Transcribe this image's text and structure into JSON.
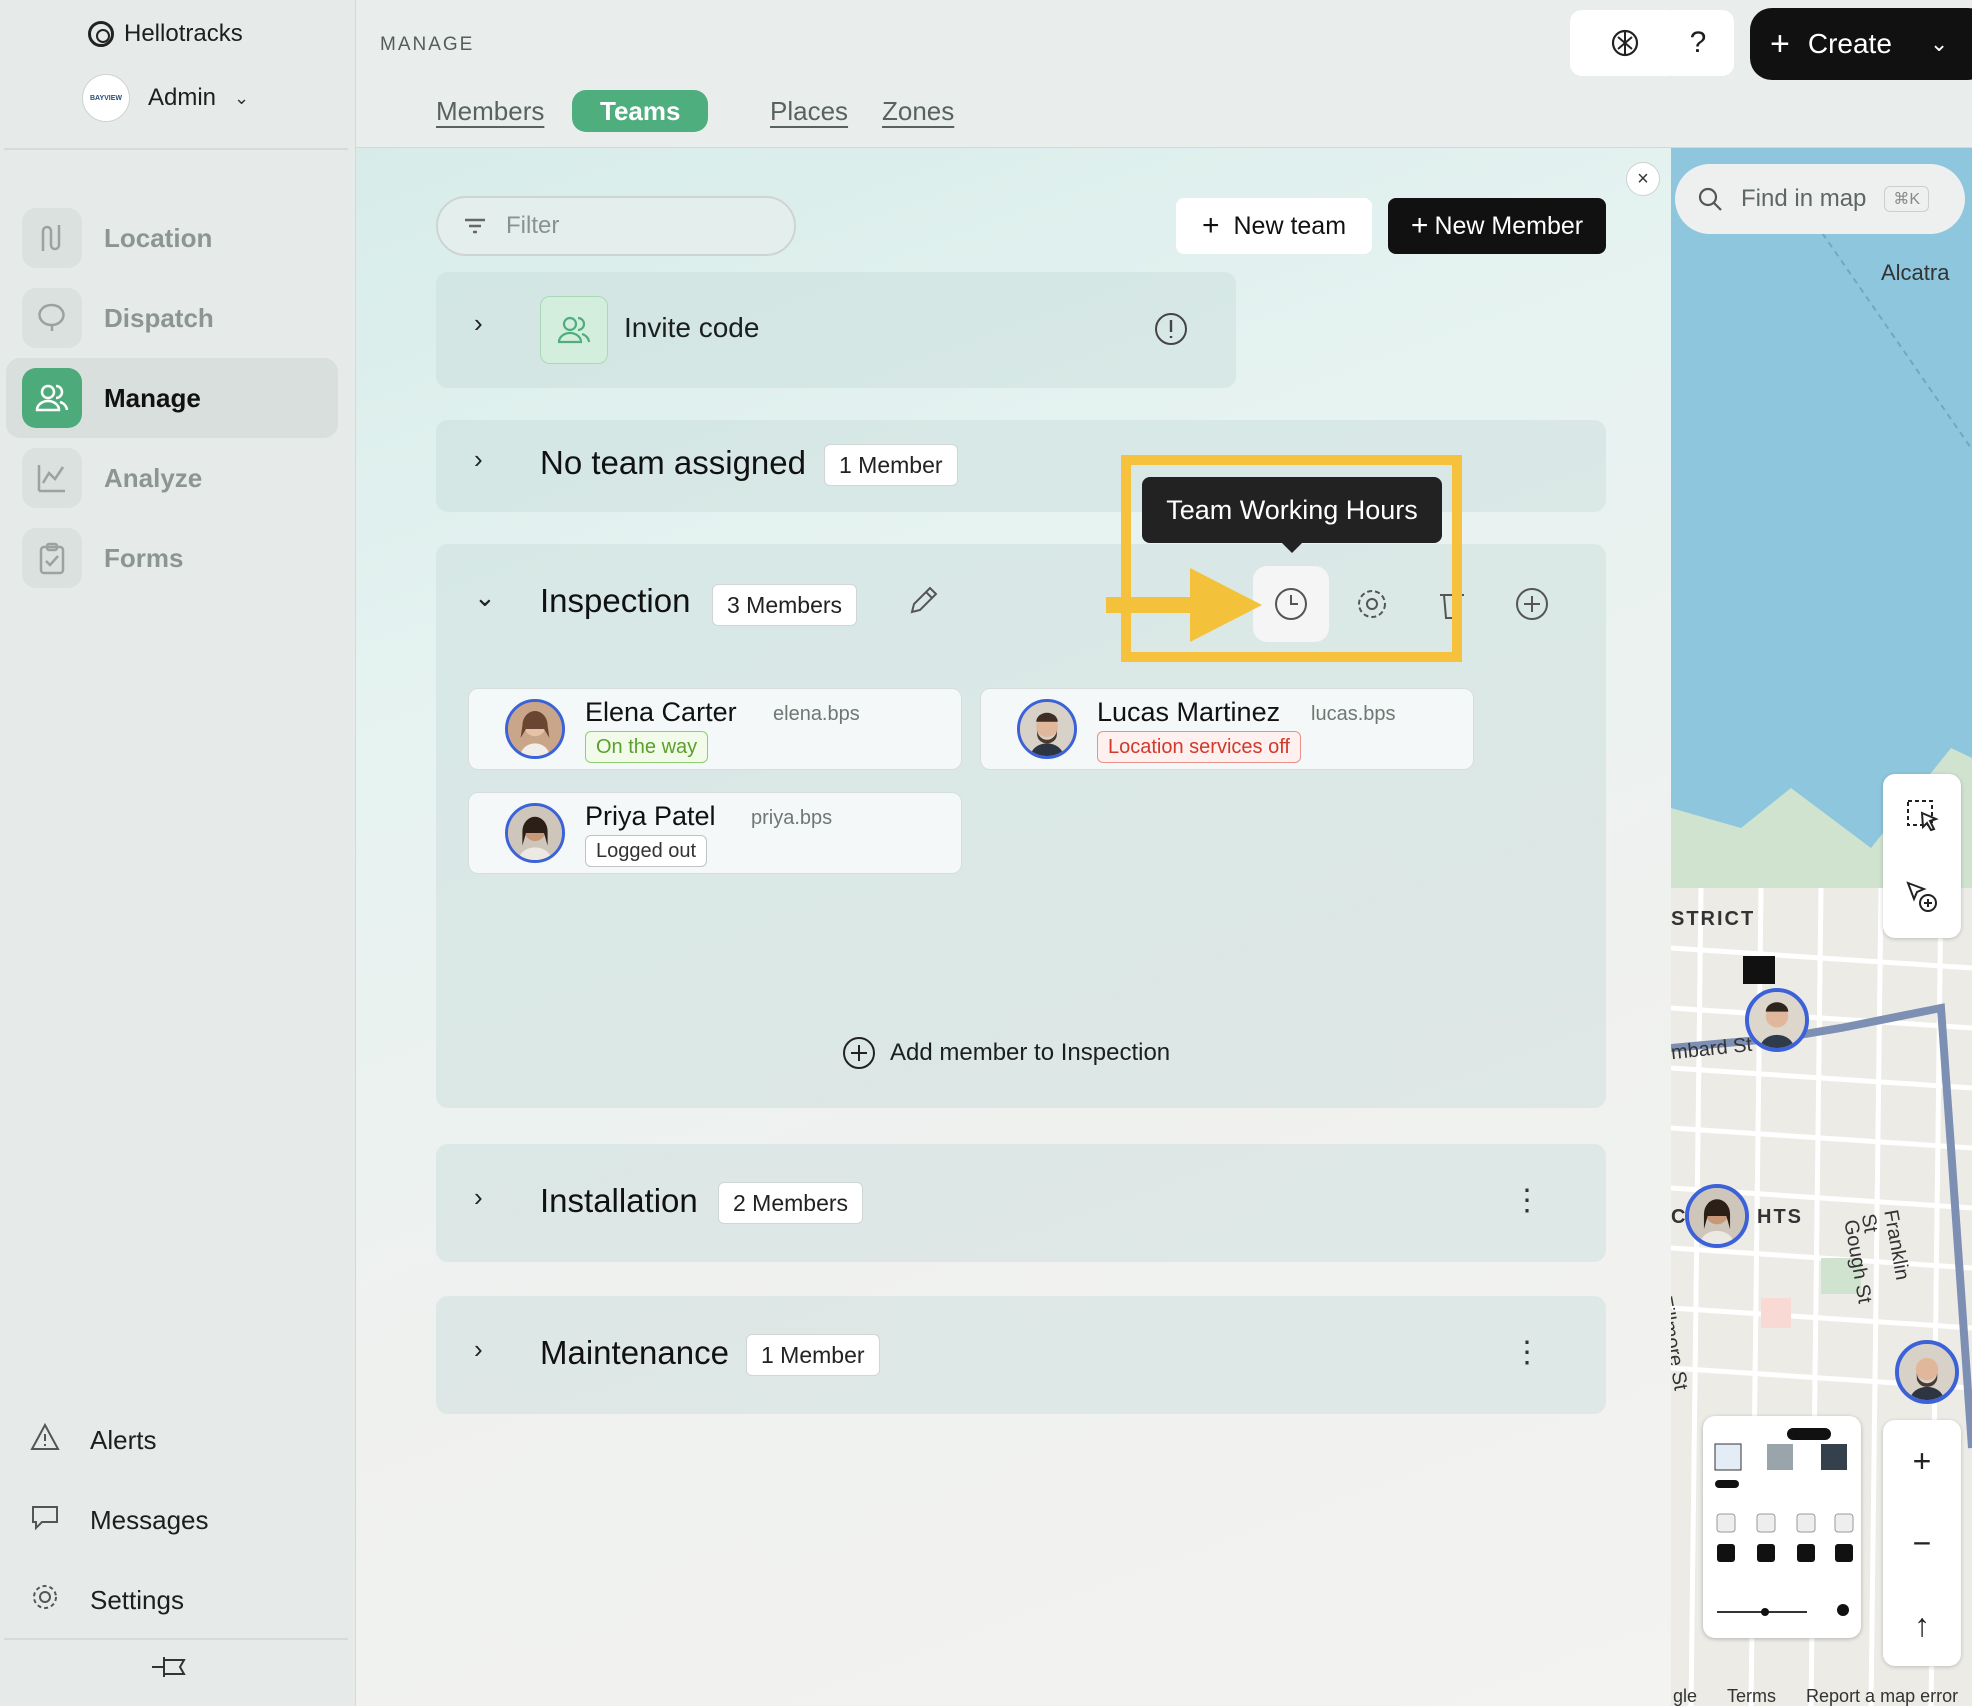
{
  "brand": {
    "name": "Hellotracks"
  },
  "account": {
    "name": "Admin",
    "org_logo_text": "BAYVIEW"
  },
  "sidebar": {
    "items": [
      {
        "label": "Location",
        "icon": "route-icon"
      },
      {
        "label": "Dispatch",
        "icon": "dispatch-icon"
      },
      {
        "label": "Manage",
        "icon": "users-icon",
        "active": true
      },
      {
        "label": "Analyze",
        "icon": "chart-icon"
      },
      {
        "label": "Forms",
        "icon": "clipboard-icon"
      }
    ],
    "bottom": [
      {
        "label": "Alerts",
        "icon": "warning-icon"
      },
      {
        "label": "Messages",
        "icon": "chat-icon"
      },
      {
        "label": "Settings",
        "icon": "gear-icon"
      }
    ]
  },
  "header": {
    "section": "MANAGE",
    "tabs": [
      "Members",
      "Teams",
      "Places",
      "Zones"
    ],
    "active_tab": "Teams",
    "help_label": "?",
    "create_label": "Create"
  },
  "toolbar": {
    "filter_placeholder": "Filter",
    "new_team_label": "New team",
    "new_member_label": "New Member"
  },
  "teams": {
    "invite": {
      "label": "Invite code"
    },
    "no_team": {
      "name": "No team assigned",
      "count": "1 Member"
    },
    "inspection": {
      "name": "Inspection",
      "count": "3 Members",
      "tooltip": "Team Working Hours",
      "members": [
        {
          "name": "Elena Carter",
          "username": "elena.bps",
          "status": "On the way"
        },
        {
          "name": "Lucas Martinez",
          "username": "lucas.bps",
          "status": "Location services off"
        },
        {
          "name": "Priya Patel",
          "username": "priya.bps",
          "status": "Logged out"
        }
      ],
      "add_member_label": "Add member to Inspection"
    },
    "installation": {
      "name": "Installation",
      "count": "2 Members"
    },
    "maintenance": {
      "name": "Maintenance",
      "count": "1 Member"
    }
  },
  "map": {
    "search_placeholder": "Find in map",
    "search_shortcut": "⌘K",
    "labels": [
      "Alcatra",
      "STRICT",
      "mbard St",
      "C",
      "HTS",
      "Fillmore St",
      "Gough St",
      "Franklin St"
    ],
    "footer": [
      "gle",
      "Terms",
      "Report a map error"
    ]
  },
  "colors": {
    "accent": "#4fae7e",
    "status_ontheway": "#5aa02c",
    "status_location_off": "#d0392b",
    "highlight": "#f6c23e"
  }
}
